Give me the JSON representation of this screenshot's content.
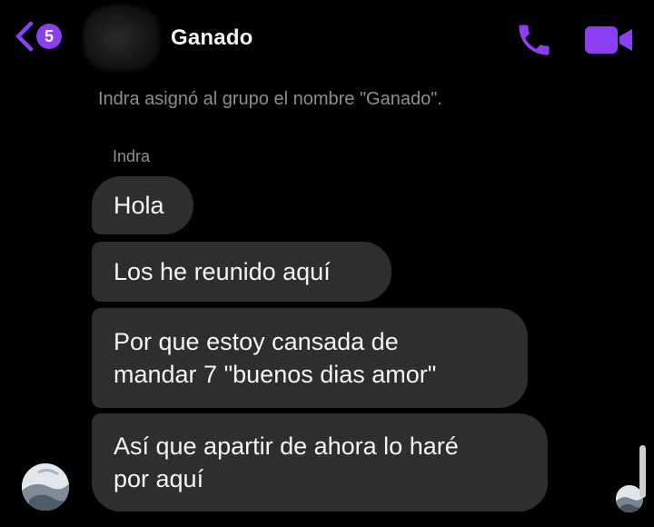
{
  "header": {
    "unread_count": "5",
    "title": "Ganado",
    "accent_color": "#8a3ff0",
    "icons": [
      "chevron-left-icon",
      "phone-icon",
      "video-camera-icon"
    ]
  },
  "conversation": {
    "system_note": "Indra asignó al grupo el nombre \"Ganado\".",
    "sender": "Indra",
    "messages": [
      {
        "lines": [
          "Hola"
        ]
      },
      {
        "lines": [
          "Los he reunido aquí"
        ]
      },
      {
        "lines": [
          "Por que estoy cansada de",
          "mandar 7 \"buenos dias amor\""
        ]
      },
      {
        "lines": [
          "Así que apartir de ahora lo haré",
          "por aquí"
        ]
      }
    ]
  }
}
